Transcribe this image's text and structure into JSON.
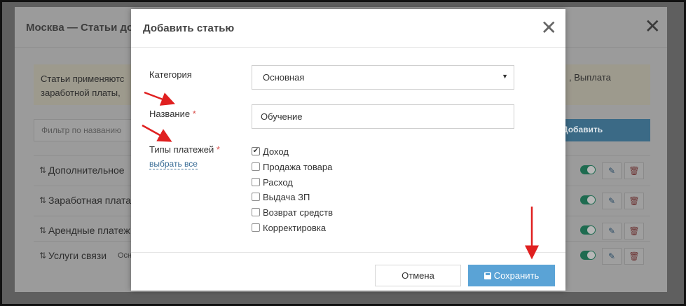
{
  "background_modal": {
    "title": "Москва — Статьи до",
    "close": "✕",
    "alert_line1": "Статьи применяютс",
    "alert_line2": "заработной платы,",
    "alert_right": ", Выплата",
    "filter_placeholder": "Фильтр по названию",
    "add_button": "Добавить",
    "rows": [
      {
        "sort": "⇅",
        "name": "Дополнительное",
        "category": ""
      },
      {
        "sort": "⇅",
        "name": "Заработная плата",
        "category": ""
      },
      {
        "sort": "⇅",
        "name": "Арендные платеж",
        "category": ""
      },
      {
        "sort": "⇅",
        "name": "Услуги связи",
        "category": "Осн"
      }
    ],
    "edit_icon": "✎",
    "delete_icon": "🗑"
  },
  "modal": {
    "title": "Добавить статью",
    "close": "✕",
    "category_label": "Категория",
    "category_value": "Основная",
    "category_arrow": "▼",
    "name_label": "Название",
    "name_value": "Обучение",
    "required_mark": "*",
    "payment_types_label": "Типы платежей",
    "select_all": "выбрать все",
    "payment_types": [
      {
        "label": "Доход",
        "checked": true
      },
      {
        "label": "Продажа товара",
        "checked": false
      },
      {
        "label": "Расход",
        "checked": false
      },
      {
        "label": "Выдача ЗП",
        "checked": false
      },
      {
        "label": "Возврат средств",
        "checked": false
      },
      {
        "label": "Корректировка",
        "checked": false
      }
    ],
    "cancel_button": "Отмена",
    "save_button": "Сохранить",
    "checkmark": "✔"
  },
  "colors": {
    "accent": "#5aa3d6",
    "required": "#d9534f",
    "annotation_arrow": "#e02020"
  }
}
